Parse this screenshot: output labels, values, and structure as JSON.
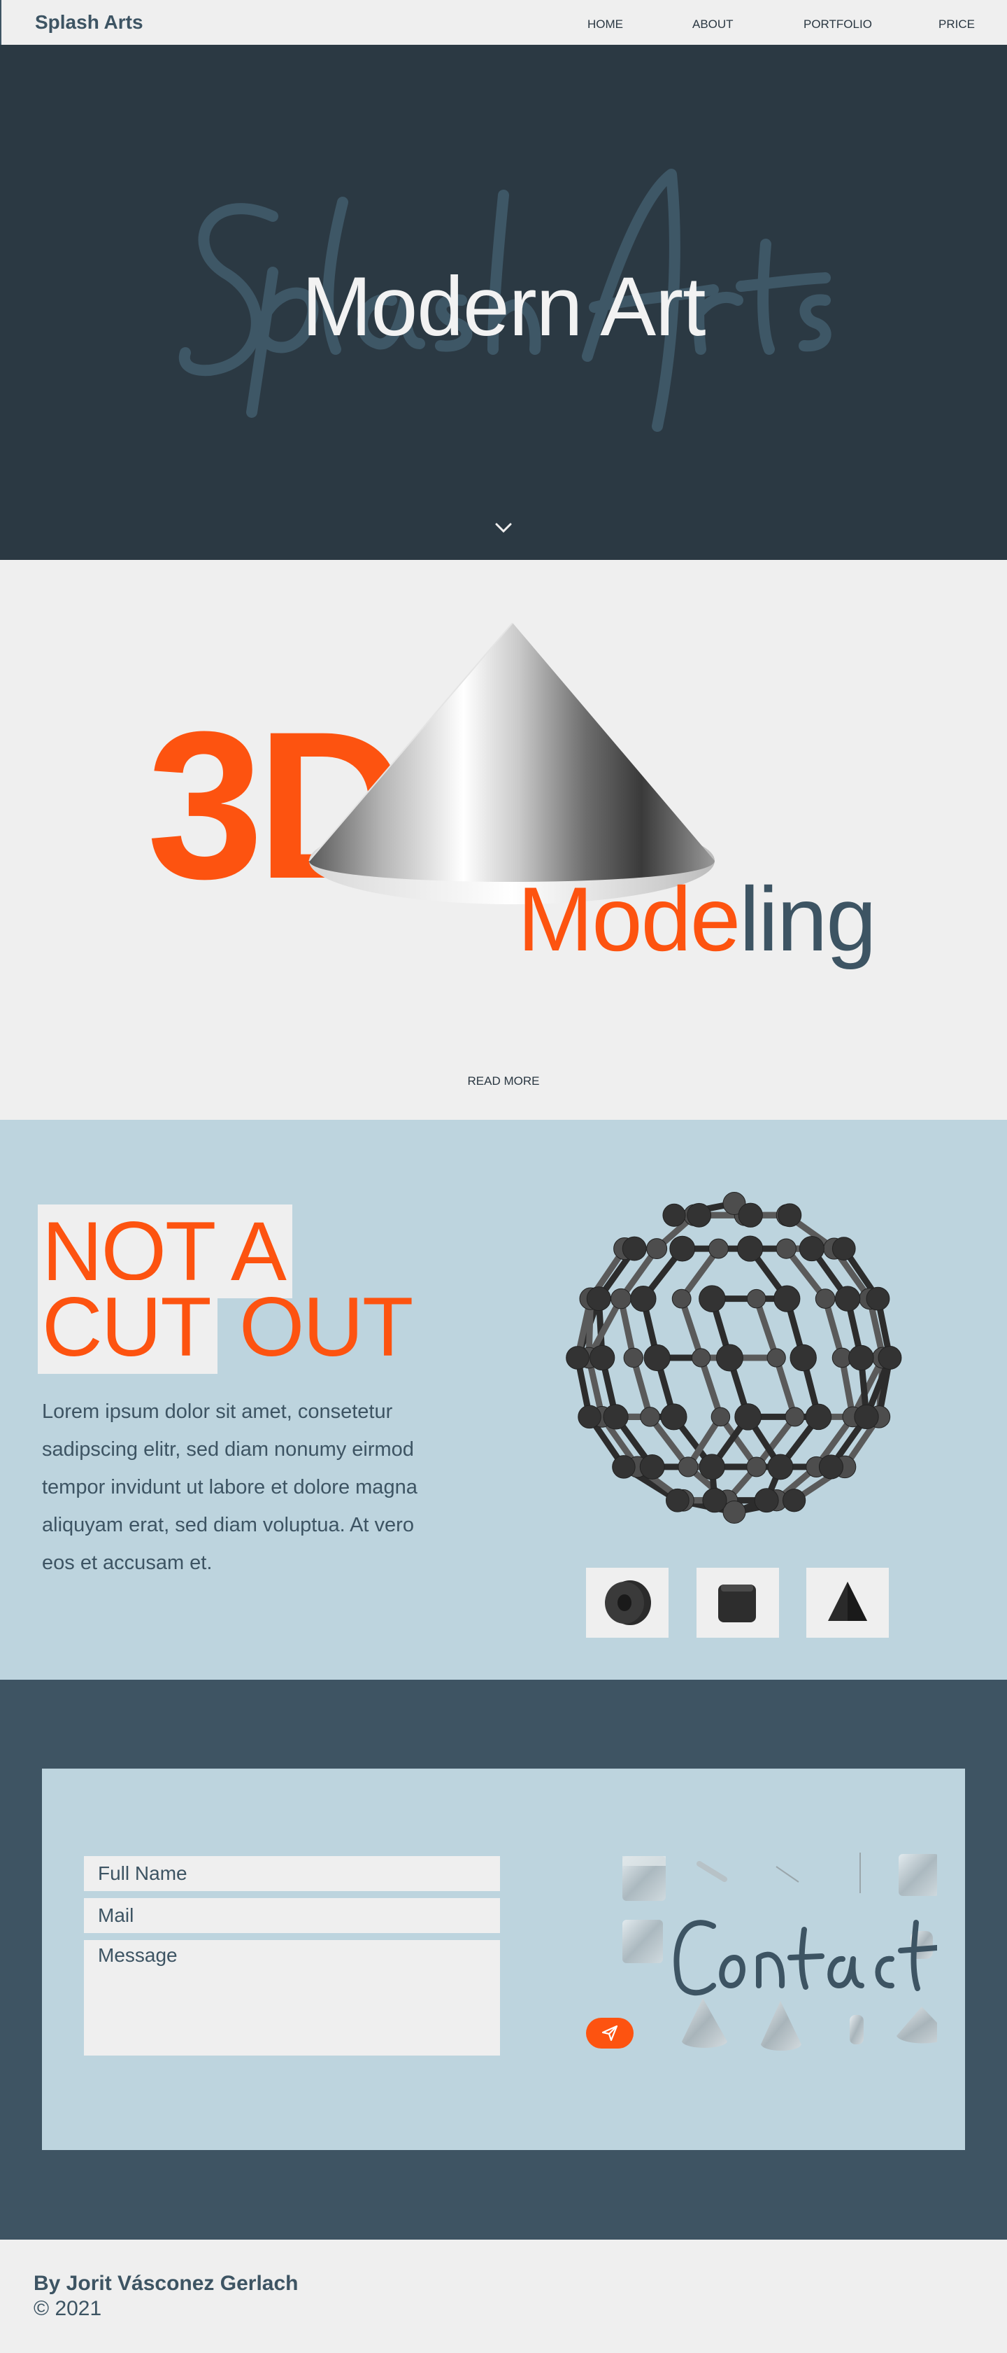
{
  "nav": {
    "brand": "Splash Arts",
    "links": [
      "HOME",
      "ABOUT",
      "PORTFOLIO",
      "PRICE"
    ]
  },
  "hero": {
    "title": "Modern Art",
    "background_script": "Splash Arts"
  },
  "modeling": {
    "big_text": "3D",
    "word_orange": "Mode",
    "word_slate": "ling",
    "read_more": "READ MORE"
  },
  "cutout": {
    "line1": "NOT A",
    "line2_highlight": "CUT",
    "line2_rest": " OUT",
    "body": "Lorem ipsum dolor sit amet, consetetur sadipscing elitr, sed diam nonumy eirmod tempor invidunt ut labore et dolore magna aliquyam erat, sed diam voluptua. At vero eos et accusam et.",
    "thumbnails": [
      "cylinder-thumbnail",
      "cube-thumbnail",
      "pyramid-thumbnail"
    ]
  },
  "contact": {
    "name_placeholder": "Full Name",
    "mail_placeholder": "Mail",
    "message_placeholder": "Message",
    "script_title": "Contact",
    "send_icon": "paper-plane-icon"
  },
  "footer": {
    "author": "By Jorit Vásconez Gerlach",
    "copyright": "© 2021"
  },
  "colors": {
    "accent_orange": "#fd5310",
    "slate": "#3d5463",
    "dark_hero": "#2b3943",
    "light_blue": "#bdd4de",
    "off_white": "#efefef"
  }
}
